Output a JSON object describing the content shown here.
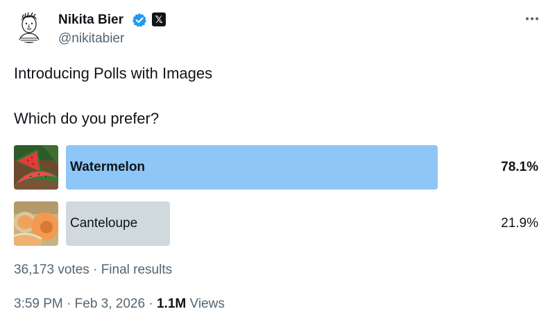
{
  "author": {
    "name": "Nikita Bier",
    "handle": "@nikitabier",
    "x_badge": "𝕏"
  },
  "tweet": {
    "line1": "Introducing Polls with Images",
    "line2": "Which do you prefer?"
  },
  "poll": {
    "options": [
      {
        "label": "Watermelon",
        "percent": "78.1%",
        "fraction": 0.781,
        "winner": true,
        "bar_color": "#8ec7f7",
        "image": "watermelon-image"
      },
      {
        "label": "Canteloupe",
        "percent": "21.9%",
        "fraction": 0.219,
        "winner": false,
        "bar_color": "#cfd9de",
        "image": "cantaloupe-image"
      }
    ],
    "votes": "36,173 votes",
    "status": "Final results",
    "separator": " · "
  },
  "timestamp": {
    "time": "3:59 PM",
    "date": "Feb 3, 2026",
    "views_count": "1.1M",
    "views_label": "Views"
  },
  "colors": {
    "verified": "#1d9bf0",
    "secondary_text": "#536471"
  },
  "icons": [
    "avatar",
    "verified-badge-icon",
    "x-logo-icon",
    "more-options-icon"
  ]
}
